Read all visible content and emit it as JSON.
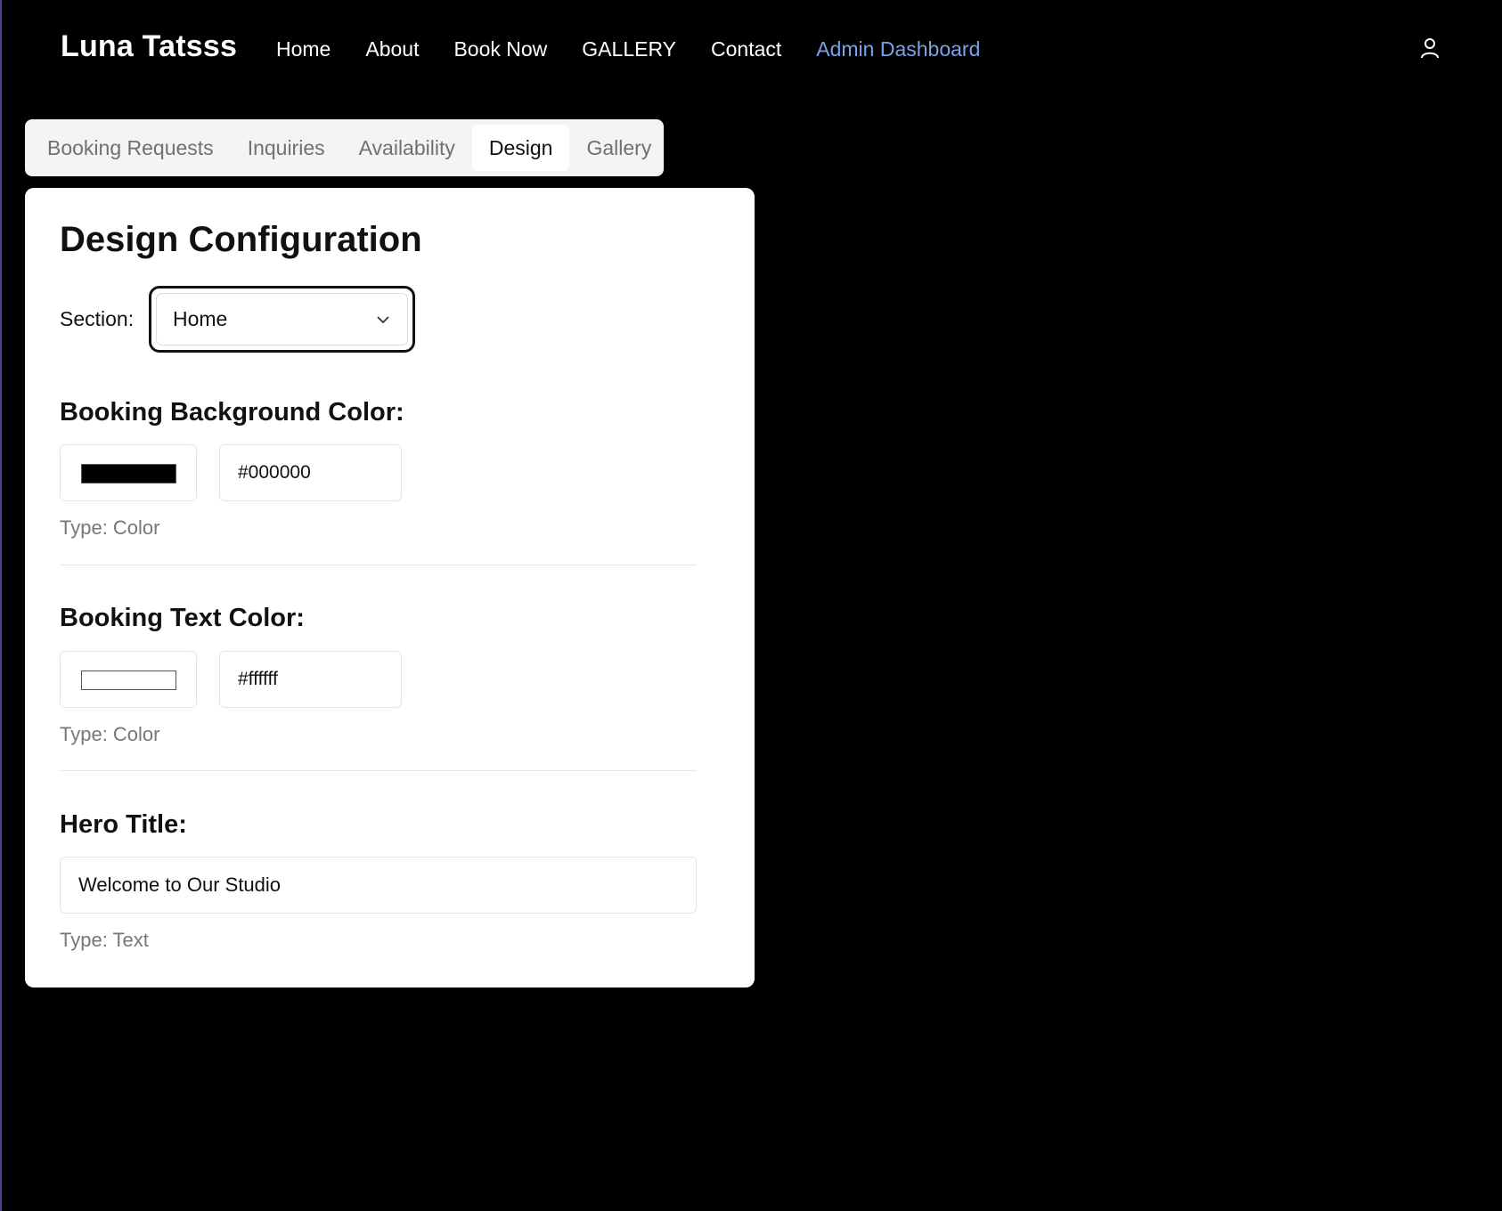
{
  "header": {
    "brand": "Luna Tatsss",
    "nav": [
      {
        "label": "Home"
      },
      {
        "label": "About"
      },
      {
        "label": "Book Now"
      },
      {
        "label": "GALLERY"
      },
      {
        "label": "Contact"
      },
      {
        "label": "Admin Dashboard",
        "active": true
      }
    ],
    "user_icon": "user-icon"
  },
  "tabs": [
    {
      "label": "Booking Requests"
    },
    {
      "label": "Inquiries"
    },
    {
      "label": "Availability"
    },
    {
      "label": "Design",
      "selected": true
    },
    {
      "label": "Gallery"
    }
  ],
  "design": {
    "title": "Design Configuration",
    "section_label": "Section:",
    "section_value": "Home",
    "fields": [
      {
        "title": "Booking Background Color:",
        "swatch_color": "#000000",
        "value": "#000000",
        "type_note": "Type: Color"
      },
      {
        "title": "Booking Text Color:",
        "swatch_color": "#ffffff",
        "value": "#ffffff",
        "type_note": "Type: Color"
      },
      {
        "title": "Hero Title:",
        "value": "Welcome to Our Studio",
        "type_note": "Type: Text"
      }
    ]
  },
  "colors": {
    "background": "#000000",
    "accent": "#7aa3e6",
    "card": "#ffffff",
    "tabs_bg": "#f4f4f5"
  }
}
